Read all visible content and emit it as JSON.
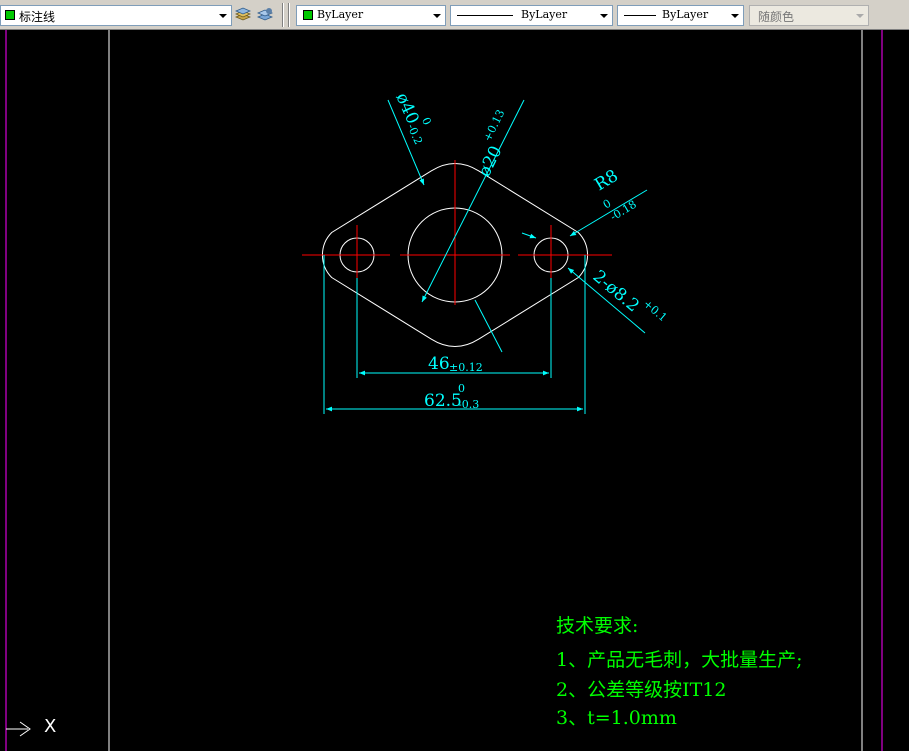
{
  "toolbar": {
    "layer_name": "标注线",
    "color_value": "ByLayer",
    "linetype_value": "ByLayer",
    "lineweight_value": "ByLayer",
    "plotstyle_value": "随颜色",
    "layer_color": "#00c800"
  },
  "drawing": {
    "dims": {
      "diam40": "ø40",
      "diam40_upper": "0",
      "diam40_lower": "-0.2",
      "diam20": "ø20",
      "diam20_tol": "+0.13",
      "radius": "R8",
      "radius_upper": "0",
      "radius_lower": "-0.18",
      "holes": "2-ø8.2",
      "holes_tol": "+0.1",
      "span46": "46",
      "span46_tol": "±0.12",
      "span62": "62.5",
      "span62_upper": "0",
      "span62_lower": "-0.3"
    },
    "notes": {
      "title": "技术要求:",
      "line1": "1、产品无毛刺，大批量生产;",
      "line2": "2、公差等级按IT12",
      "line3": "3、t=1.0mm"
    },
    "ucs_label": "X",
    "colors": {
      "background": "#000000",
      "outline": "#ffffff",
      "dimension": "#00ffff",
      "centerline": "#ff0000",
      "notes": "#00ff00",
      "viewport_border": "#ff00ff"
    }
  }
}
